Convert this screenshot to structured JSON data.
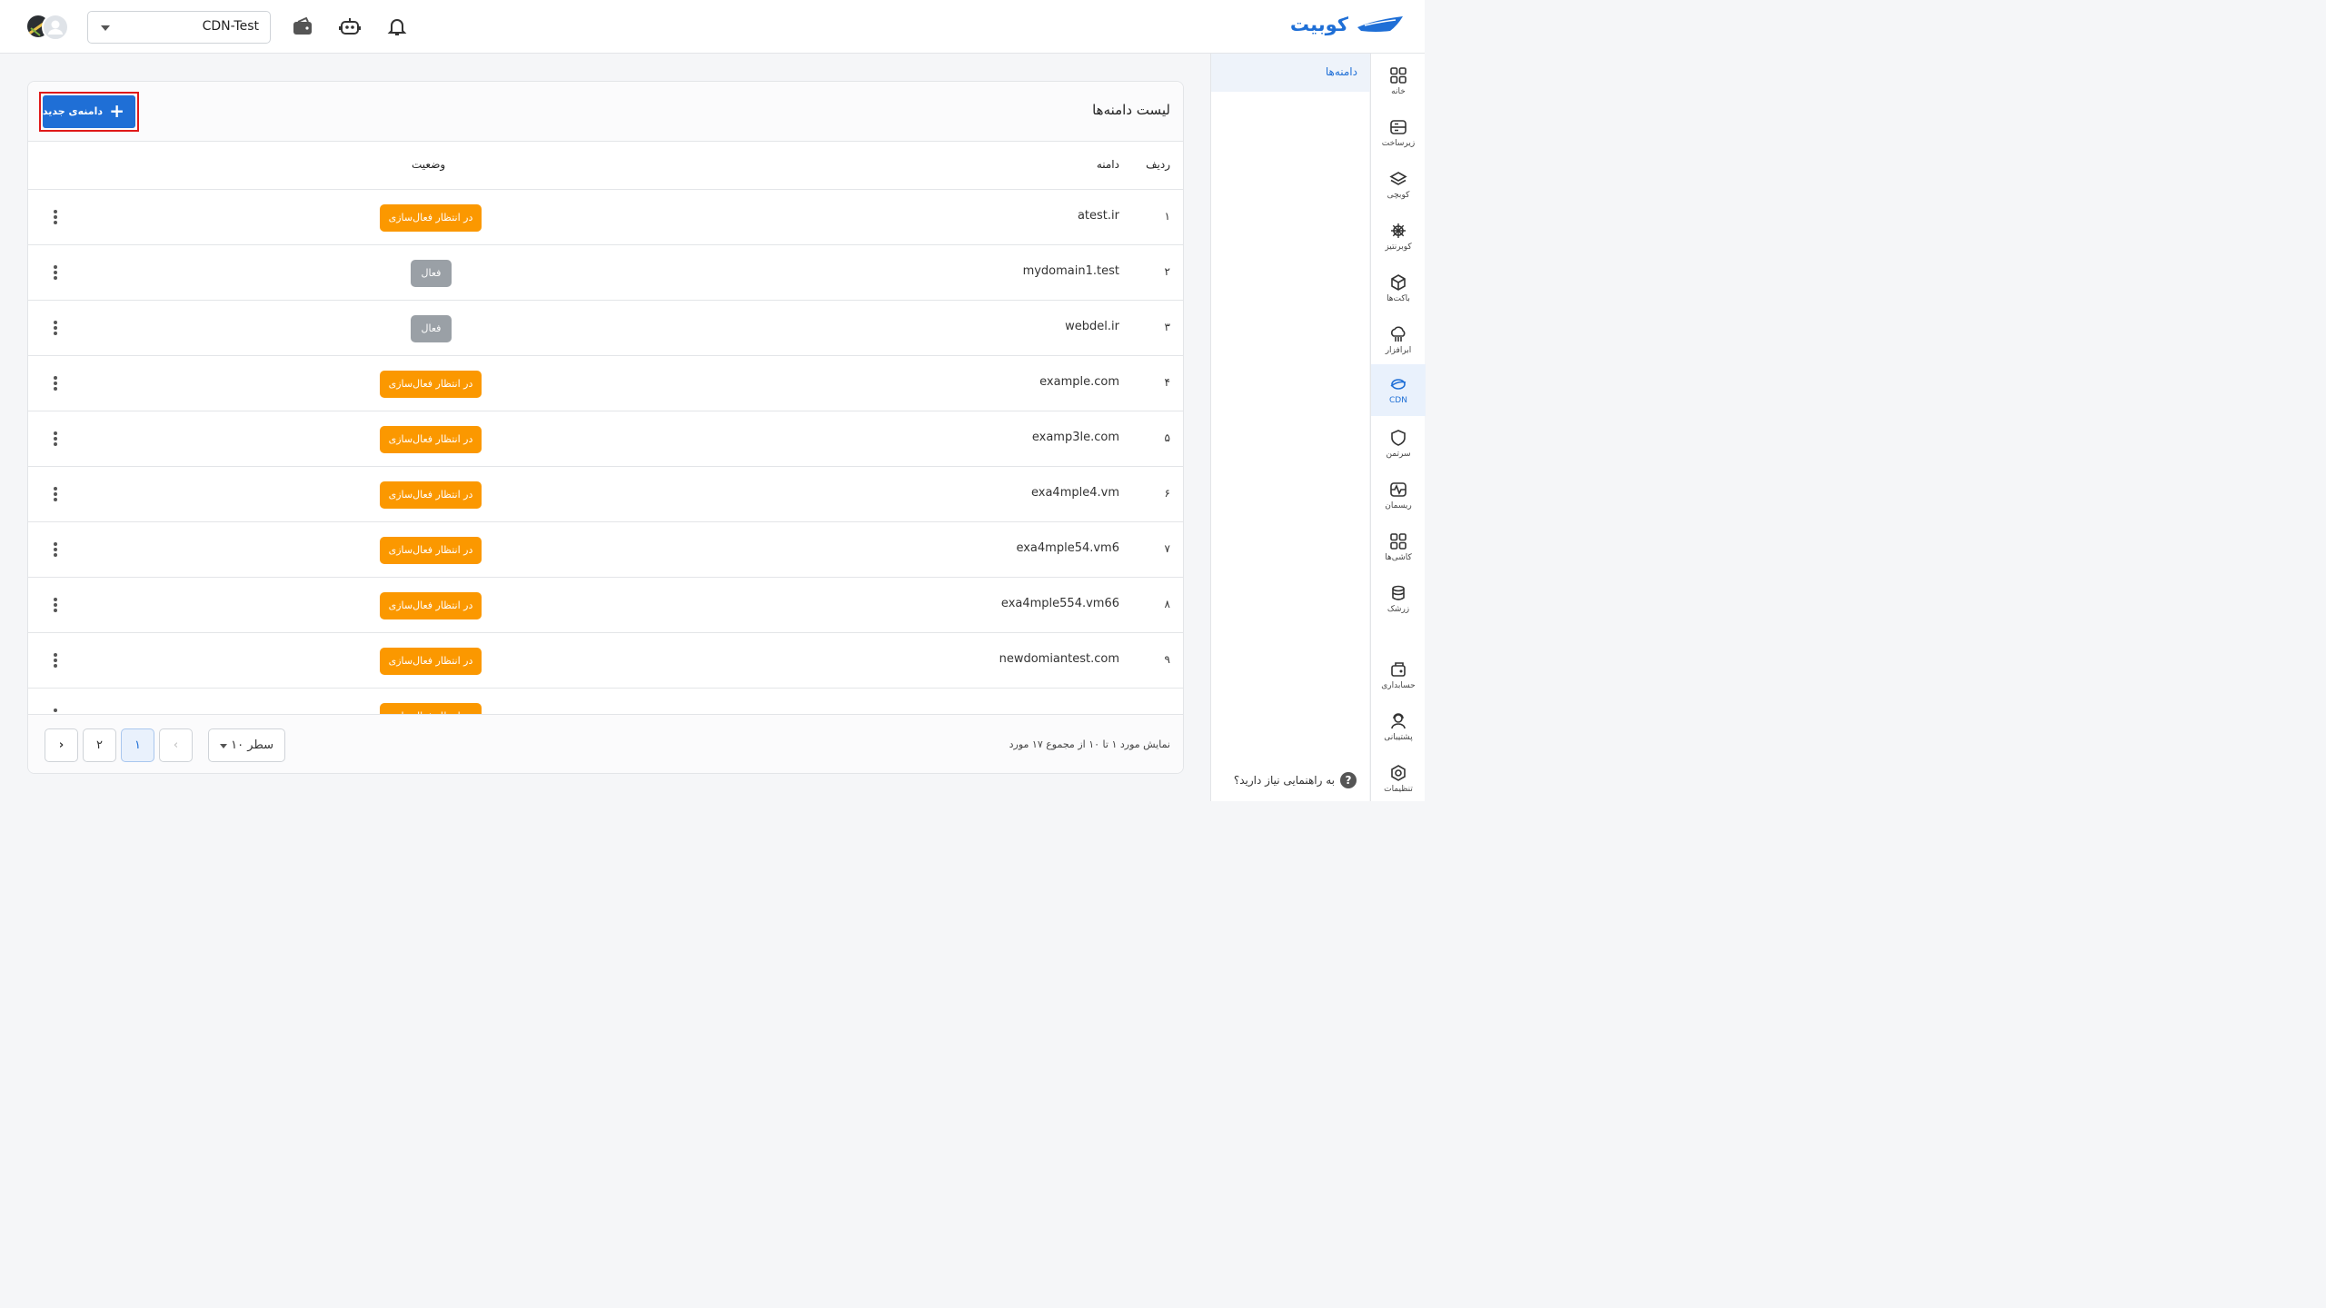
{
  "header": {
    "logo_text": "کوبیت",
    "project": "CDN-Test",
    "brand_color": "#1f6fd6"
  },
  "sidebar": {
    "items": [
      {
        "label": "خانه",
        "icon": "grid-icon"
      },
      {
        "label": "زیرساخت",
        "icon": "server-icon"
      },
      {
        "label": "کوبچی",
        "icon": "layers-icon"
      },
      {
        "label": "کوبرنتیز",
        "icon": "helm-icon"
      },
      {
        "label": "باکت‌ها",
        "icon": "box-icon"
      },
      {
        "label": "ابرافزار",
        "icon": "cloud-icon"
      },
      {
        "label": "CDN",
        "icon": "globe-icon",
        "active": true
      },
      {
        "label": "سرتمن",
        "icon": "shield-icon"
      },
      {
        "label": "ریسمان",
        "icon": "pulse-icon"
      },
      {
        "label": "کاشی‌ها",
        "icon": "tiles-icon"
      },
      {
        "label": "زرشک",
        "icon": "stack-icon"
      },
      {
        "label": "حسابداری",
        "icon": "accounting-icon"
      },
      {
        "label": "پشتیبانی",
        "icon": "support-icon"
      },
      {
        "label": "تنظیمات",
        "icon": "settings-icon"
      }
    ]
  },
  "subnav": {
    "active_item": "دامنه‌ها",
    "help_text": "به راهنمایی نیاز دارید؟",
    "help_icon": "?"
  },
  "main": {
    "title": "لیست دامنه‌ها",
    "add_button": "دامنه‌ی جدید",
    "columns": {
      "index": "ردیف",
      "domain": "دامنه",
      "status": "وضعیت"
    },
    "rows": [
      {
        "index": "۱",
        "domain": "atest.ir",
        "status": "در انتظار فعال‌سازی",
        "state": "pending"
      },
      {
        "index": "۲",
        "domain": "mydomain1.test",
        "status": "فعال",
        "state": "active"
      },
      {
        "index": "۳",
        "domain": "webdel.ir",
        "status": "فعال",
        "state": "active"
      },
      {
        "index": "۴",
        "domain": "example.com",
        "status": "در انتظار فعال‌سازی",
        "state": "pending"
      },
      {
        "index": "۵",
        "domain": "examp3le.com",
        "status": "در انتظار فعال‌سازی",
        "state": "pending"
      },
      {
        "index": "۶",
        "domain": "exa4mple4.vm",
        "status": "در انتظار فعال‌سازی",
        "state": "pending"
      },
      {
        "index": "۷",
        "domain": "exa4mple54.vm6",
        "status": "در انتظار فعال‌سازی",
        "state": "pending"
      },
      {
        "index": "۸",
        "domain": "exa4mple554.vm66",
        "status": "در انتظار فعال‌سازی",
        "state": "pending"
      },
      {
        "index": "۹",
        "domain": "newdomiantest.com",
        "status": "در انتظار فعال‌سازی",
        "state": "pending"
      },
      {
        "index": "",
        "domain": "",
        "status": "در انتظار فعال‌سازی",
        "state": "pending"
      }
    ],
    "status_colors": {
      "pending": "#fb9800",
      "active": "#9aa0a6"
    }
  },
  "footer": {
    "info": "نمایش مورد ۱ تا ۱۰ از مجموع ۱۷ مورد",
    "rows_per_page": "۱۰ سطر",
    "pages": [
      "۱",
      "۲"
    ],
    "current_page": "۱",
    "prev_icon": "‹",
    "next_icon": "›"
  }
}
